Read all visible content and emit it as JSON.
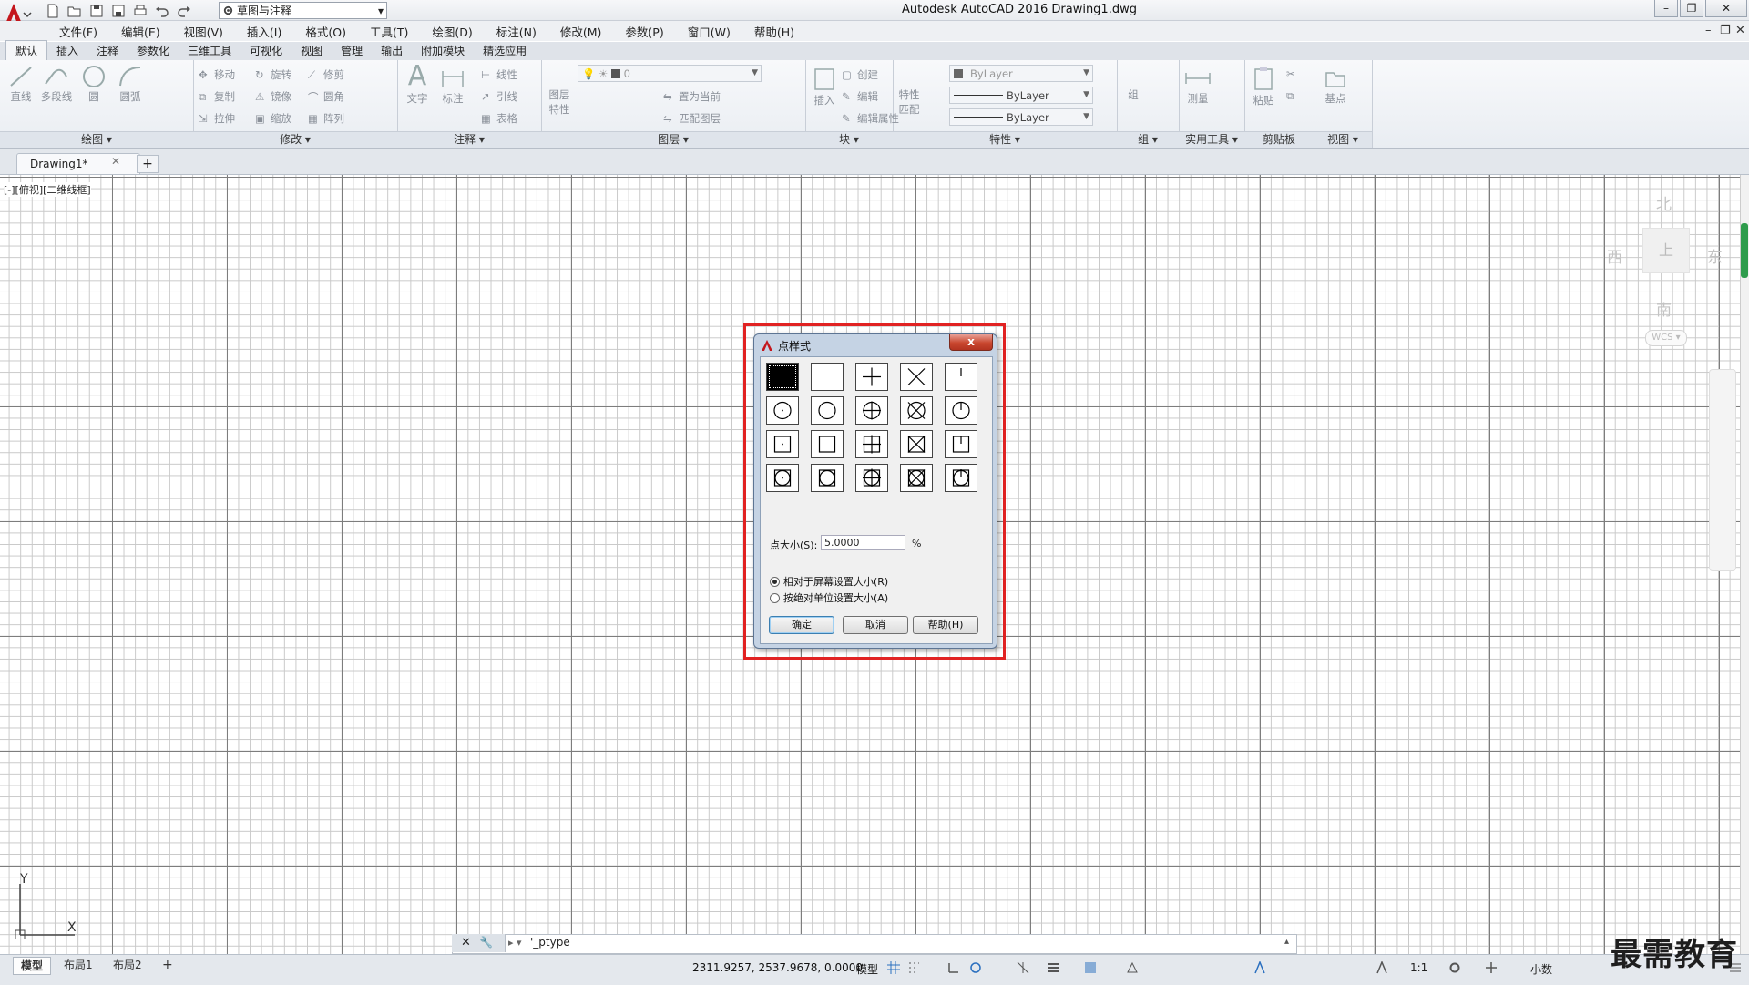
{
  "window": {
    "title": "Autodesk AutoCAD 2016    Drawing1.dwg",
    "workspace": "草图与注释"
  },
  "menu": [
    "文件(F)",
    "编辑(E)",
    "视图(V)",
    "插入(I)",
    "格式(O)",
    "工具(T)",
    "绘图(D)",
    "标注(N)",
    "修改(M)",
    "参数(P)",
    "窗口(W)",
    "帮助(H)"
  ],
  "ribbon_tabs": [
    "默认",
    "插入",
    "注释",
    "参数化",
    "三维工具",
    "可视化",
    "视图",
    "管理",
    "输出",
    "附加模块",
    "精选应用"
  ],
  "ribbon": {
    "draw": {
      "title": "绘图",
      "line": "直线",
      "polyline": "多段线",
      "circle": "圆",
      "arc": "圆弧"
    },
    "modify": {
      "title": "修改",
      "move": "移动",
      "rotate": "旋转",
      "trim": "修剪",
      "copy": "复制",
      "mirror": "镜像",
      "fillet": "圆角",
      "stretch": "拉伸",
      "scale": "缩放",
      "array": "阵列"
    },
    "annotation": {
      "title": "注释",
      "text": "文字",
      "dimension": "标注",
      "linear": "线性",
      "leader": "引线",
      "table": "表格"
    },
    "layers": {
      "title": "图层",
      "layer_props": "图层特性",
      "current_layer": "0",
      "set_current": "置为当前",
      "match_layer": "匹配图层"
    },
    "block": {
      "title": "块",
      "insert": "插入",
      "create": "创建",
      "edit": "编辑",
      "edit_attr": "编辑属性"
    },
    "properties": {
      "title": "特性",
      "match": "特性匹配",
      "color": "ByLayer",
      "linetype": "ByLayer",
      "lineweight": "ByLayer"
    },
    "groups": {
      "title": "组",
      "group": "组"
    },
    "utilities": {
      "title": "实用工具",
      "measure": "测量"
    },
    "clipboard": {
      "title": "剪贴板",
      "paste": "粘贴"
    },
    "view": {
      "title": "视图",
      "base": "基点"
    }
  },
  "doc_tab": "Drawing1*",
  "viewport_label": "[-][俯视][二维线框]",
  "viewcube": {
    "north": "北",
    "south": "南",
    "east": "东",
    "west": "西",
    "top": "上",
    "wcs": "WCS"
  },
  "dialog": {
    "title": "点样式",
    "point_size_label": "点大小(S):",
    "point_size_value": "5.0000",
    "percent": "%",
    "radio_relative": "相对于屏幕设置大小(R)",
    "radio_absolute": "按绝对单位设置大小(A)",
    "ok": "确定",
    "cancel": "取消",
    "help": "帮助(H)",
    "close": "x",
    "selected_style": 0
  },
  "command_line": "'_ptype",
  "layout_tabs": [
    "模型",
    "布局1",
    "布局2"
  ],
  "status": {
    "coords": "2311.9257, 2537.9678, 0.0000",
    "model": "模型",
    "scale": "1:1",
    "units": "小数"
  },
  "ucs": {
    "x": "X",
    "y": "Y"
  },
  "watermark": "最需教育"
}
